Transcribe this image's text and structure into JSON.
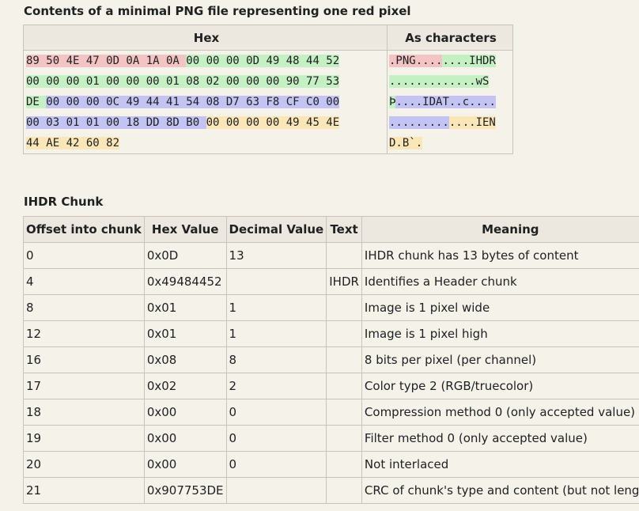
{
  "caption_hex": "Contents of a minimal PNG file representing one red pixel",
  "hex_table": {
    "headers": [
      "Hex",
      "As characters"
    ],
    "hex_lines": [
      [
        {
          "t": "89 50 4E 47 0D 0A 1A 0A ",
          "c": "r"
        },
        {
          "t": "00 00 00 0D 49 48 44 52",
          "c": "g"
        }
      ],
      [
        {
          "t": "00 00 00 01 00 00 00 01 08 02 00 00 00 90 77 53",
          "c": "g"
        }
      ],
      [
        {
          "t": "DE ",
          "c": "g"
        },
        {
          "t": "00 00 00 0C 49 44 41 54 08 D7 63 F8 CF C0 00",
          "c": "b"
        }
      ],
      [
        {
          "t": "00 03 01 01 00 18 DD 8D B0 ",
          "c": "b"
        },
        {
          "t": "00 00 00 00 49 45 4E",
          "c": "y"
        }
      ],
      [
        {
          "t": "44 AE 42 60 82",
          "c": "y"
        }
      ]
    ],
    "char_lines": [
      [
        {
          "t": ".PNG....",
          "c": "r"
        },
        {
          "t": "....IHDR",
          "c": "g"
        }
      ],
      [
        {
          "t": ".............wS",
          "c": "g"
        }
      ],
      [
        {
          "t": "Þ",
          "c": "g"
        },
        {
          "t": "....IDAT..c....",
          "c": "b"
        }
      ],
      [
        {
          "t": ".........",
          "c": "b"
        },
        {
          "t": "....IEN",
          "c": "y"
        }
      ],
      [
        {
          "t": "D.B`.",
          "c": "y"
        }
      ]
    ]
  },
  "caption_ihdr": "IHDR Chunk",
  "ihdr_table": {
    "headers": [
      "Offset into chunk",
      "Hex Value",
      "Decimal Value",
      "Text",
      "Meaning"
    ],
    "rows": [
      [
        "0",
        "0x0D",
        "13",
        "",
        "IHDR chunk has 13 bytes of content"
      ],
      [
        "4",
        "0x49484452",
        "",
        "IHDR",
        "Identifies a Header chunk"
      ],
      [
        "8",
        "0x01",
        "1",
        "",
        "Image is 1 pixel wide"
      ],
      [
        "12",
        "0x01",
        "1",
        "",
        "Image is 1 pixel high"
      ],
      [
        "16",
        "0x08",
        "8",
        "",
        "8 bits per pixel (per channel)"
      ],
      [
        "17",
        "0x02",
        "2",
        "",
        "Color type 2 (RGB/truecolor)"
      ],
      [
        "18",
        "0x00",
        "0",
        "",
        "Compression method 0 (only accepted value)"
      ],
      [
        "19",
        "0x00",
        "0",
        "",
        "Filter method 0 (only accepted value)"
      ],
      [
        "20",
        "0x00",
        "0",
        "",
        "Not interlaced"
      ],
      [
        "21",
        "0x907753DE",
        "",
        "",
        "CRC of chunk's type and content (but not length)"
      ]
    ]
  }
}
